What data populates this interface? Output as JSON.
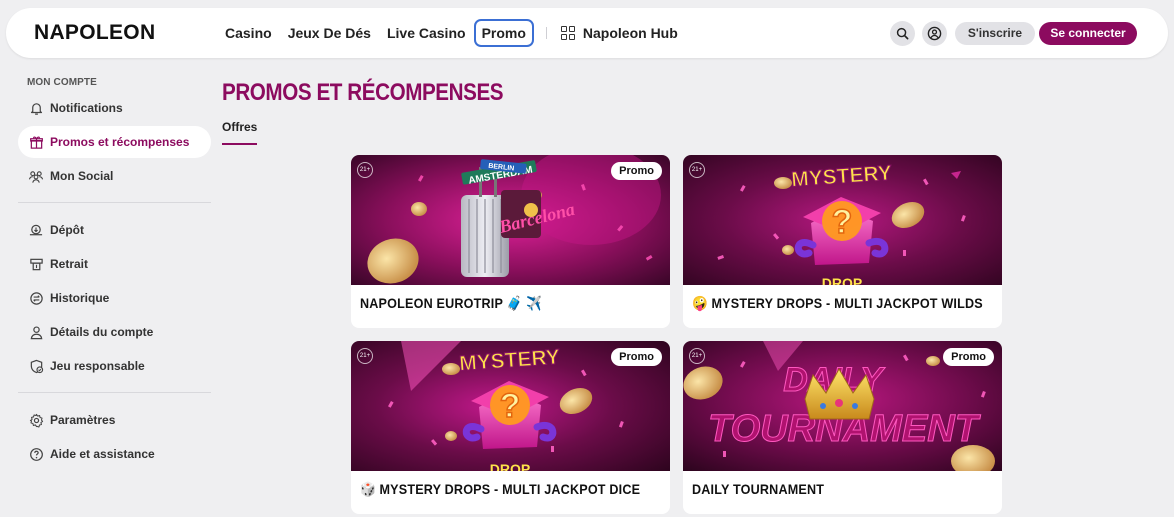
{
  "brand": "NAPOLEON",
  "nav": {
    "items": [
      "Casino",
      "Jeux De Dés",
      "Live Casino",
      "Promo"
    ],
    "active_index": 3,
    "hub_label": "Napoleon Hub"
  },
  "header": {
    "register_label": "S'inscrire",
    "login_label": "Se connecter"
  },
  "sidebar": {
    "section_title": "MON COMPTE",
    "group1": [
      {
        "label": "Notifications",
        "icon": "bell-icon"
      },
      {
        "label": "Promos et récompenses",
        "icon": "gift-icon",
        "active": true
      },
      {
        "label": "Mon Social",
        "icon": "people-icon"
      }
    ],
    "group2": [
      {
        "label": "Dépôt",
        "icon": "deposit-icon"
      },
      {
        "label": "Retrait",
        "icon": "withdraw-icon"
      },
      {
        "label": "Historique",
        "icon": "history-icon"
      },
      {
        "label": "Détails du compte",
        "icon": "user-icon"
      },
      {
        "label": "Jeu responsable",
        "icon": "shield-check-icon"
      }
    ],
    "group3": [
      {
        "label": "Paramètres",
        "icon": "gear-icon"
      },
      {
        "label": "Aide et assistance",
        "icon": "help-icon"
      }
    ]
  },
  "main": {
    "title": "PROMOS ET RÉCOMPENSES",
    "tab": "Offres",
    "cards": [
      {
        "title": "NAPOLEON EUROTRIP",
        "emoji_suffix": "🧳 ✈️",
        "emoji_prefix": "",
        "badge": "Promo",
        "age": "21+",
        "art": "eurotrip",
        "sign_1": "BERLIN",
        "sign_2": "AMSTERDAM",
        "sign_3": "Barcelona"
      },
      {
        "title": "MYSTERY DROPS - MULTI JACKPOT WILDS",
        "emoji_prefix": "🤪",
        "emoji_suffix": "",
        "badge": "",
        "age": "21+",
        "art": "mystery",
        "art_text_1": "MYSTERY",
        "art_text_2": "DROP"
      },
      {
        "title": "MYSTERY DROPS - MULTI JACKPOT DICE",
        "emoji_prefix": "🎲",
        "emoji_suffix": "",
        "badge": "Promo",
        "age": "21+",
        "art": "mystery",
        "art_text_1": "MYSTERY",
        "art_text_2": "DROP"
      },
      {
        "title": "DAILY TOURNAMENT",
        "emoji_prefix": "",
        "emoji_suffix": "",
        "badge": "Promo",
        "age": "21+",
        "art": "tournament",
        "art_text_1": "DAILY",
        "art_text_2": "TOURNAMENT"
      }
    ]
  },
  "colors": {
    "accent": "#8c0b5f",
    "nav_active_border": "#3b6fd4",
    "background": "#efeff1"
  }
}
